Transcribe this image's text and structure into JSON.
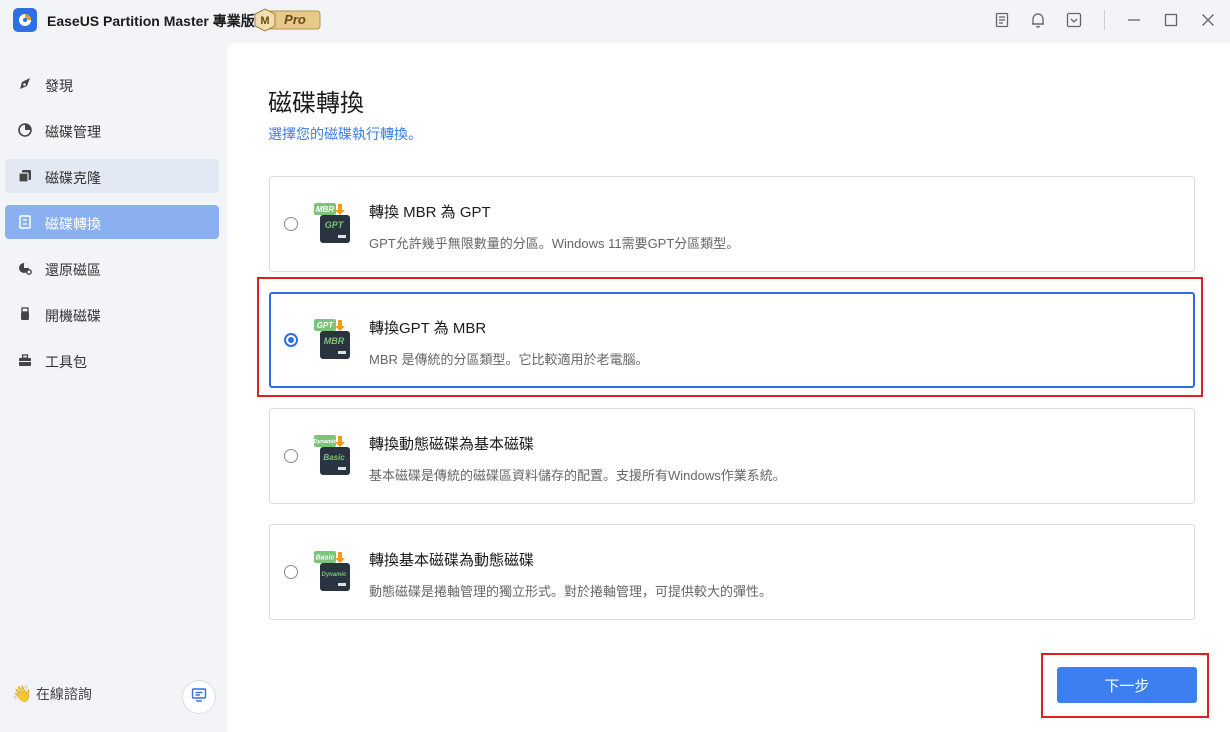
{
  "app": {
    "title": "EaseUS Partition Master 專業版",
    "badge_letter": "M",
    "badge_text": "Pro"
  },
  "titlebar_icons": [
    "notes-icon",
    "bell-icon",
    "download-icon",
    "minimize-icon",
    "maximize-icon",
    "close-icon"
  ],
  "sidebar": {
    "items": [
      {
        "label": "發現",
        "icon": "discover-icon",
        "state": "normal"
      },
      {
        "label": "磁碟管理",
        "icon": "pie-icon",
        "state": "normal"
      },
      {
        "label": "磁碟克隆",
        "icon": "clone-icon",
        "state": "hover"
      },
      {
        "label": "磁碟轉換",
        "icon": "convert-icon",
        "state": "active"
      },
      {
        "label": "還原磁區",
        "icon": "recover-icon",
        "state": "normal"
      },
      {
        "label": "開機磁碟",
        "icon": "usb-icon",
        "state": "normal"
      },
      {
        "label": "工具包",
        "icon": "toolbox-icon",
        "state": "normal"
      }
    ],
    "consult_label": "在線諮詢"
  },
  "main": {
    "title": "磁碟轉換",
    "subtitle": "選擇您的磁碟執行轉換。",
    "options": [
      {
        "title": "轉換 MBR 為 GPT",
        "desc": "GPT允許幾乎無限數量的分區。Windows 11需要GPT分區類型。",
        "icon_top": "MBR",
        "icon_bottom": "GPT",
        "selected": false
      },
      {
        "title": "轉換GPT 為 MBR",
        "desc": "MBR 是傳統的分區類型。它比較適用於老電腦。",
        "icon_top": "GPT",
        "icon_bottom": "MBR",
        "selected": true
      },
      {
        "title": "轉換動態磁碟為基本磁碟",
        "desc": "基本磁碟是傳統的磁碟區資料儲存的配置。支援所有Windows作業系統。",
        "icon_top": "Dynamic",
        "icon_bottom": "Basic",
        "selected": false
      },
      {
        "title": "轉換基本磁碟為動態磁碟",
        "desc": "動態磁碟是捲軸管理的獨立形式。對於捲軸管理，可提供較大的彈性。",
        "icon_top": "Basic",
        "icon_bottom": "Dynamic",
        "selected": false
      }
    ],
    "next_label": "下一步"
  },
  "colors": {
    "accent": "#2f6fe6",
    "active_nav": "#8bb0f2",
    "highlight": "#e02020",
    "icon_green": "#7cc47a",
    "arrow_orange": "#f29b1d"
  }
}
